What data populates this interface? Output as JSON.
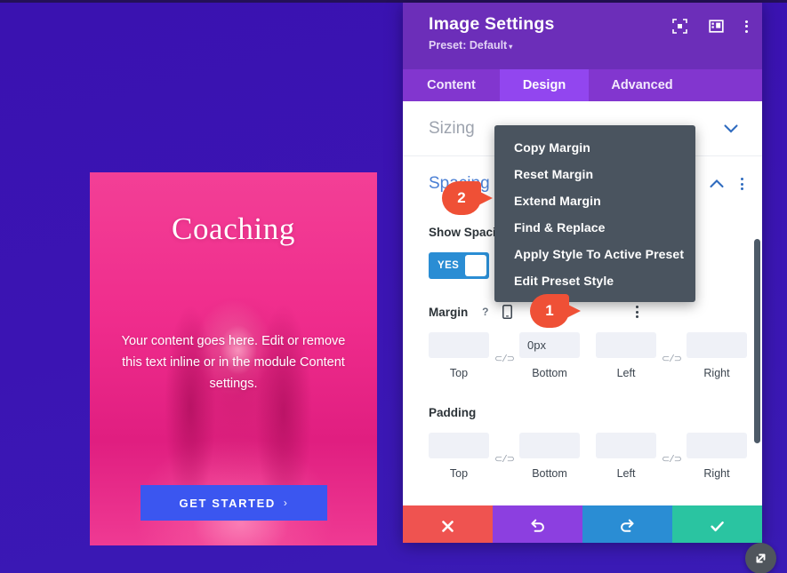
{
  "preview": {
    "title": "Coaching",
    "body": "Your content goes here. Edit or remove this text inline or in the module Content settings.",
    "button_label": "GET STARTED",
    "button_chevron": "›",
    "accent_color": "#3b56f0",
    "bg_color": "#ec2a8c"
  },
  "modal": {
    "title": "Image Settings",
    "preset": "Preset: Default",
    "preset_caret": "▾",
    "header_icons": [
      {
        "name": "focus-mode-icon"
      },
      {
        "name": "view-layout-icon"
      },
      {
        "name": "more-options-icon"
      }
    ],
    "tabs": [
      {
        "label": "Content",
        "active": false
      },
      {
        "label": "Design",
        "active": true
      },
      {
        "label": "Advanced",
        "active": false
      }
    ]
  },
  "sections": {
    "sizing": {
      "title": "Sizing",
      "collapsed": true
    },
    "spacing": {
      "title": "Spacing",
      "collapsed": false,
      "show_spacing_label": "Show Spacing",
      "toggle_value": "YES",
      "groups": [
        {
          "name": "Margin",
          "help": "?",
          "fields": [
            {
              "caption": "Top",
              "value": ""
            },
            {
              "caption": "Bottom",
              "value": "0px"
            },
            {
              "caption": "Left",
              "value": ""
            },
            {
              "caption": "Right",
              "value": ""
            }
          ],
          "link_icon": "⊂/⊃"
        },
        {
          "name": "Padding",
          "fields": [
            {
              "caption": "Top",
              "value": ""
            },
            {
              "caption": "Bottom",
              "value": ""
            },
            {
              "caption": "Left",
              "value": ""
            },
            {
              "caption": "Right",
              "value": ""
            }
          ],
          "link_icon": "⊂/⊃"
        }
      ]
    }
  },
  "dropdown": {
    "items": [
      "Copy Margin",
      "Reset Margin",
      "Extend Margin",
      "Find & Replace",
      "Apply Style To Active Preset",
      "Edit Preset Style"
    ]
  },
  "callouts": [
    {
      "number": "1",
      "target": "margin-options-dots"
    },
    {
      "number": "2",
      "target": "extend-margin-item"
    }
  ],
  "footer": {
    "buttons": [
      {
        "name": "cancel-button",
        "icon": "close-icon",
        "color": "#ef5350"
      },
      {
        "name": "undo-button",
        "icon": "undo-icon",
        "color": "#8c3fe0"
      },
      {
        "name": "redo-button",
        "icon": "redo-icon",
        "color": "#2a8dd4"
      },
      {
        "name": "save-button",
        "icon": "check-icon",
        "color": "#2ac4a1"
      }
    ]
  },
  "resize_handle": {
    "icon": "resize-diagonal-icon"
  }
}
